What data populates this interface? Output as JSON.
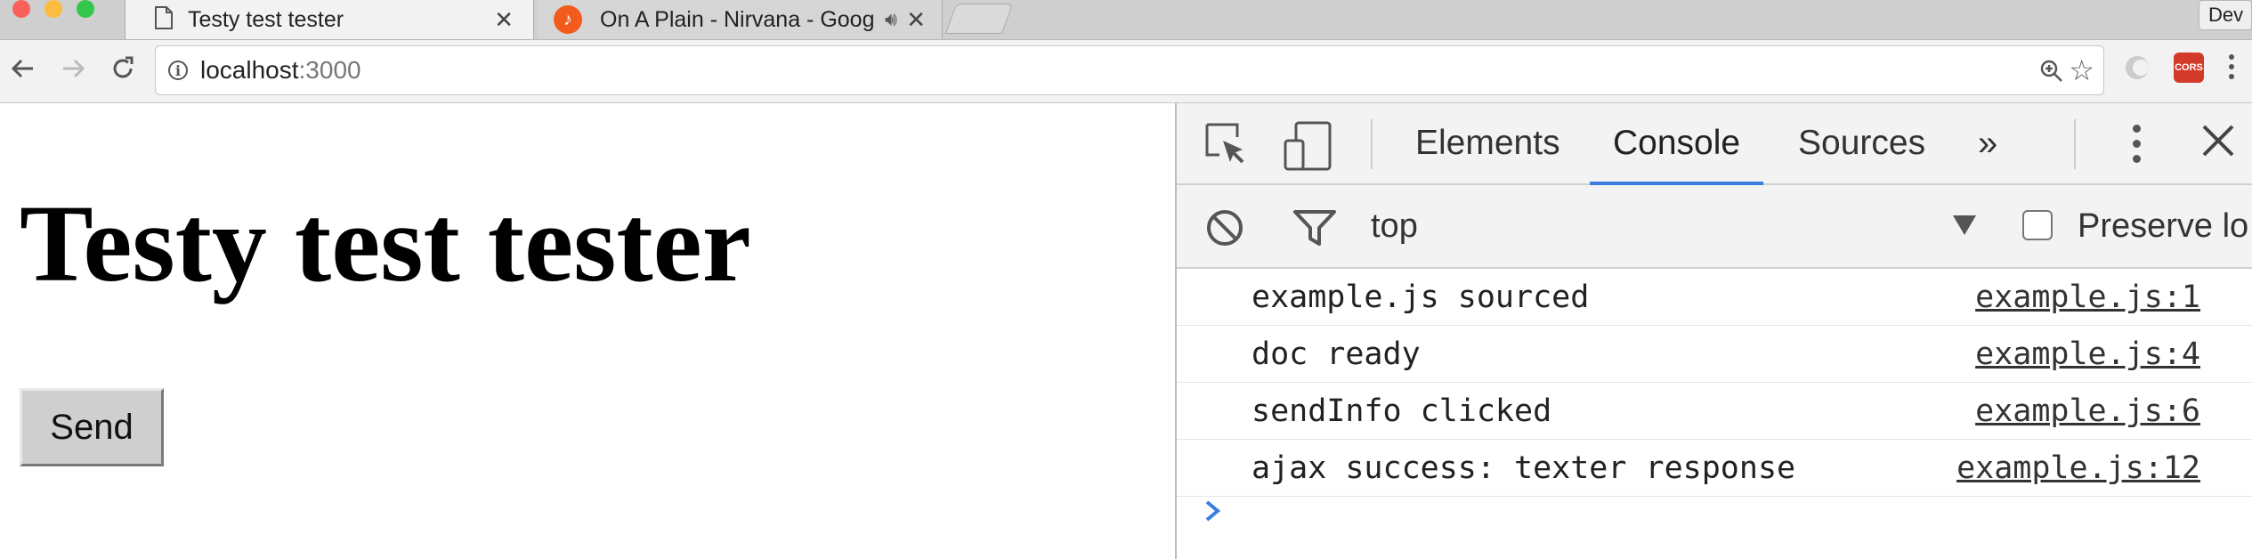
{
  "browser": {
    "tabs": [
      {
        "title": "Testy test tester",
        "active": true
      },
      {
        "title": "On A Plain - Nirvana - Goog",
        "active": false,
        "audio": true
      }
    ],
    "profile_label": "Dev",
    "address": {
      "host": "localhost",
      "port": ":3000"
    },
    "extensions": {
      "cors_label": "CORS"
    }
  },
  "page": {
    "title": "Testy test tester",
    "send_label": "Send"
  },
  "devtools": {
    "tabs": [
      "Elements",
      "Console",
      "Sources"
    ],
    "more_tabs": "»",
    "active_tab": "Console",
    "context": "top",
    "preserve_log_label": "Preserve lo",
    "messages": [
      {
        "text": "example.js sourced",
        "source": "example.js:1"
      },
      {
        "text": "doc ready",
        "source": "example.js:4"
      },
      {
        "text": "sendInfo clicked",
        "source": "example.js:6"
      },
      {
        "text": "ajax success: texter response",
        "source": "example.js:12"
      }
    ],
    "accent_color": "#3b7ee0"
  }
}
